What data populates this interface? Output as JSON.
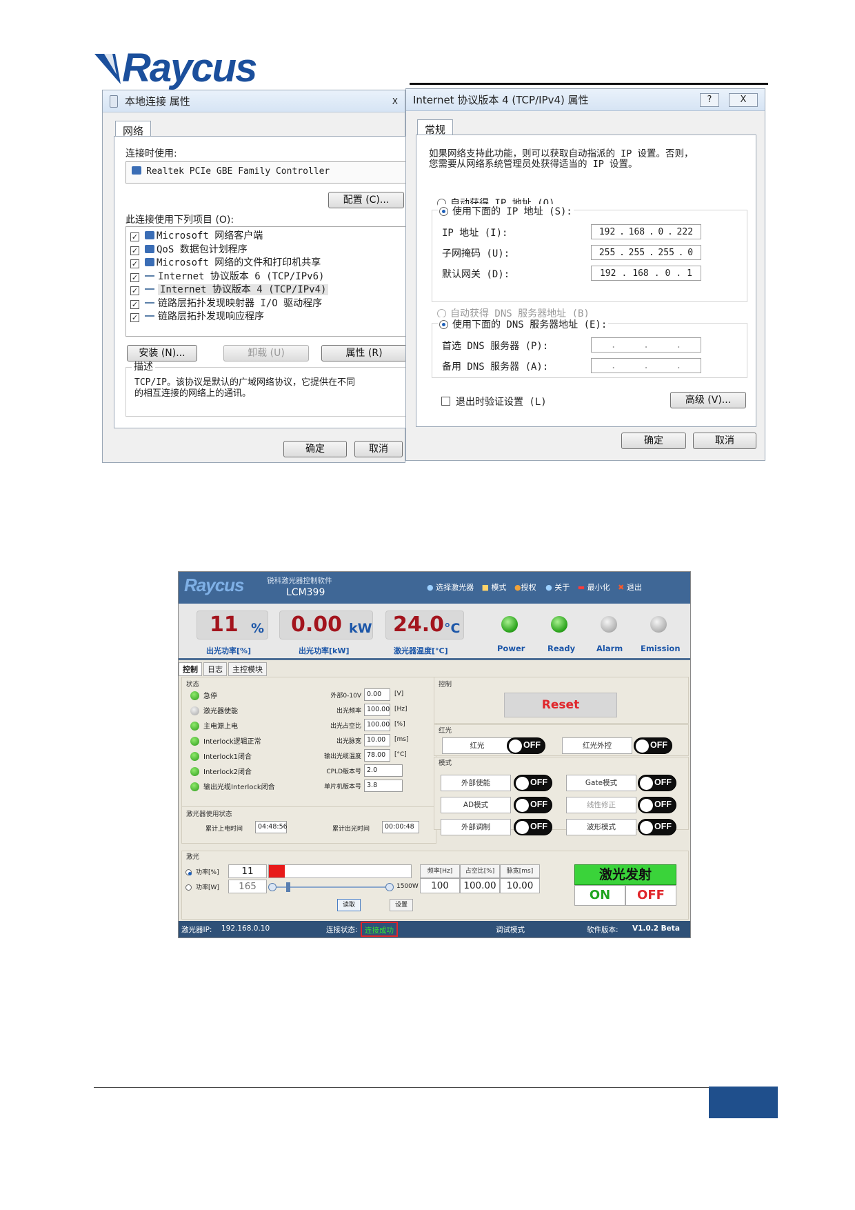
{
  "brand": {
    "name": "Raycus",
    "color": "#1b4f9c"
  },
  "local_conn": {
    "title": "本地连接 属性",
    "tab": "网络",
    "connect_using_label": "连接时使用:",
    "adapter": "Realtek PCIe GBE Family Controller",
    "configure_btn": "配置 (C)...",
    "items_label": "此连接使用下列项目 (O):",
    "items": [
      "Microsoft 网络客户端",
      "QoS 数据包计划程序",
      "Microsoft 网络的文件和打印机共享",
      "Internet 协议版本 6 (TCP/IPv6)",
      "Internet 协议版本 4 (TCP/IPv4)",
      "链路层拓扑发现映射器 I/O 驱动程序",
      "链路层拓扑发现响应程序"
    ],
    "install_btn": "安装 (N)...",
    "uninstall_btn": "卸载 (U)",
    "properties_btn": "属性 (R)",
    "desc_title": "描述",
    "desc_text_1": "TCP/IP。该协议是默认的广域网络协议，它提供在不同",
    "desc_text_2": "的相互连接的网络上的通讯。",
    "ok_btn": "确定",
    "cancel_btn": "取消",
    "title_tail": "X"
  },
  "ipv4": {
    "title": "Internet 协议版本 4 (TCP/IPv4) 属性",
    "help_btn": "?",
    "close_btn": "X",
    "tab": "常规",
    "intro_1": "如果网络支持此功能，则可以获取自动指派的 IP 设置。否则，",
    "intro_2": "您需要从网络系统管理员处获得适当的 IP 设置。",
    "auto_ip": "自动获得 IP 地址 (O)",
    "use_ip": "使用下面的 IP 地址 (S):",
    "ip_label": "IP 地址 (I):",
    "ip": [
      "192",
      "168",
      "0",
      "222"
    ],
    "mask_label": "子网掩码 (U):",
    "mask": [
      "255",
      "255",
      "255",
      "0"
    ],
    "gw_label": "默认网关 (D):",
    "gw": [
      "192",
      "168",
      "0",
      "1"
    ],
    "auto_dns": "自动获得 DNS 服务器地址 (B)",
    "use_dns": "使用下面的 DNS 服务器地址 (E):",
    "dns1_label": "首选 DNS 服务器 (P):",
    "dns2_label": "备用 DNS 服务器 (A):",
    "validate_label": "退出时验证设置 (L)",
    "advanced_btn": "高级 (V)...",
    "ok_btn": "确定",
    "cancel_btn": "取消"
  },
  "laser_app": {
    "logo": "Raycus",
    "subtitle": "锐科激光器控制软件",
    "model": "LCM399",
    "menu": [
      {
        "icon": "laser-select-icon",
        "label": "选择激光器"
      },
      {
        "icon": "mode-icon",
        "label": "模式"
      },
      {
        "icon": "auth-icon",
        "label": "授权"
      },
      {
        "icon": "about-icon",
        "label": "关于"
      },
      {
        "icon": "minimize-icon",
        "label": "最小化"
      },
      {
        "icon": "exit-icon",
        "label": "退出"
      }
    ],
    "metrics": [
      {
        "value": "11",
        "unit": "%",
        "label": "出光功率[%]"
      },
      {
        "value": "0.00",
        "unit": "kW",
        "label": "出光功率[kW]"
      },
      {
        "value": "24.0",
        "unit": "°C",
        "label": "激光器温度[°C]"
      }
    ],
    "indicators": [
      {
        "label": "Power",
        "state": "green"
      },
      {
        "label": "Ready",
        "state": "green"
      },
      {
        "label": "Alarm",
        "state": "gray"
      },
      {
        "label": "Emission",
        "state": "gray"
      }
    ],
    "tabs": [
      "控制",
      "日志",
      "主控模块"
    ],
    "status_title": "状态",
    "status_items": [
      {
        "label": "急停",
        "state": "green"
      },
      {
        "label": "激光器使能",
        "state": "gray"
      },
      {
        "label": "主电源上电",
        "state": "green"
      },
      {
        "label": "Interlock逻辑正常",
        "state": "green"
      },
      {
        "label": "Interlock1闭合",
        "state": "green"
      },
      {
        "label": "Interlock2闭合",
        "state": "green"
      },
      {
        "label": "输出光缆Interlock闭合",
        "state": "green"
      }
    ],
    "params": [
      {
        "label": "外部0-10V",
        "value": "0.00",
        "unit": "[V]"
      },
      {
        "label": "出光频率",
        "value": "100.00",
        "unit": "[Hz]"
      },
      {
        "label": "出光占空比",
        "value": "100.00",
        "unit": "[%]"
      },
      {
        "label": "出光脉宽",
        "value": "10.00",
        "unit": "[ms]"
      },
      {
        "label": "输出光缆温度",
        "value": "78.00",
        "unit": "[°C]"
      },
      {
        "label": "CPLD版本号",
        "value": "2.0",
        "unit": ""
      },
      {
        "label": "单片机版本号",
        "value": "3.8",
        "unit": ""
      }
    ],
    "usage_title": "激光器使用状态",
    "power_on_time_label": "累计上电时间",
    "power_on_time": "04:48:56",
    "emission_time_label": "累计出光时间",
    "emission_time": "00:00:48",
    "control_title": "控制",
    "reset_btn": "Reset",
    "red_title": "红光",
    "red_light": "红光",
    "red_external": "红光外控",
    "mode_title": "模式",
    "modes_left": [
      "外部使能",
      "AD模式",
      "外部调制"
    ],
    "modes_right": [
      "Gate模式",
      "线性修正",
      "波形模式"
    ],
    "toggle_text": "OFF",
    "laser_title": "激光",
    "power_pct_label": "功率[%]",
    "power_pct": "11",
    "power_w_label": "功率[W]",
    "power_w": "165",
    "power_fraction": 0.11,
    "max_power": "1500W",
    "freq_head": "频率[Hz]",
    "duty_head": "占空比[%]",
    "pulse_head": "脉宽[ms]",
    "freq": "100",
    "duty": "100.00",
    "pulse": "10.00",
    "read_btn": "读取",
    "set_btn": "设置",
    "emit_title": "激光发射",
    "on_btn": "ON",
    "off_btn": "OFF",
    "ip_label": "激光器IP:",
    "ip": "192.168.0.10",
    "conn_label": "连接状态:",
    "conn_state": "连接成功",
    "debug_mode": "调试模式",
    "version_label": "软件版本:",
    "version": "V1.0.2 Beta"
  }
}
